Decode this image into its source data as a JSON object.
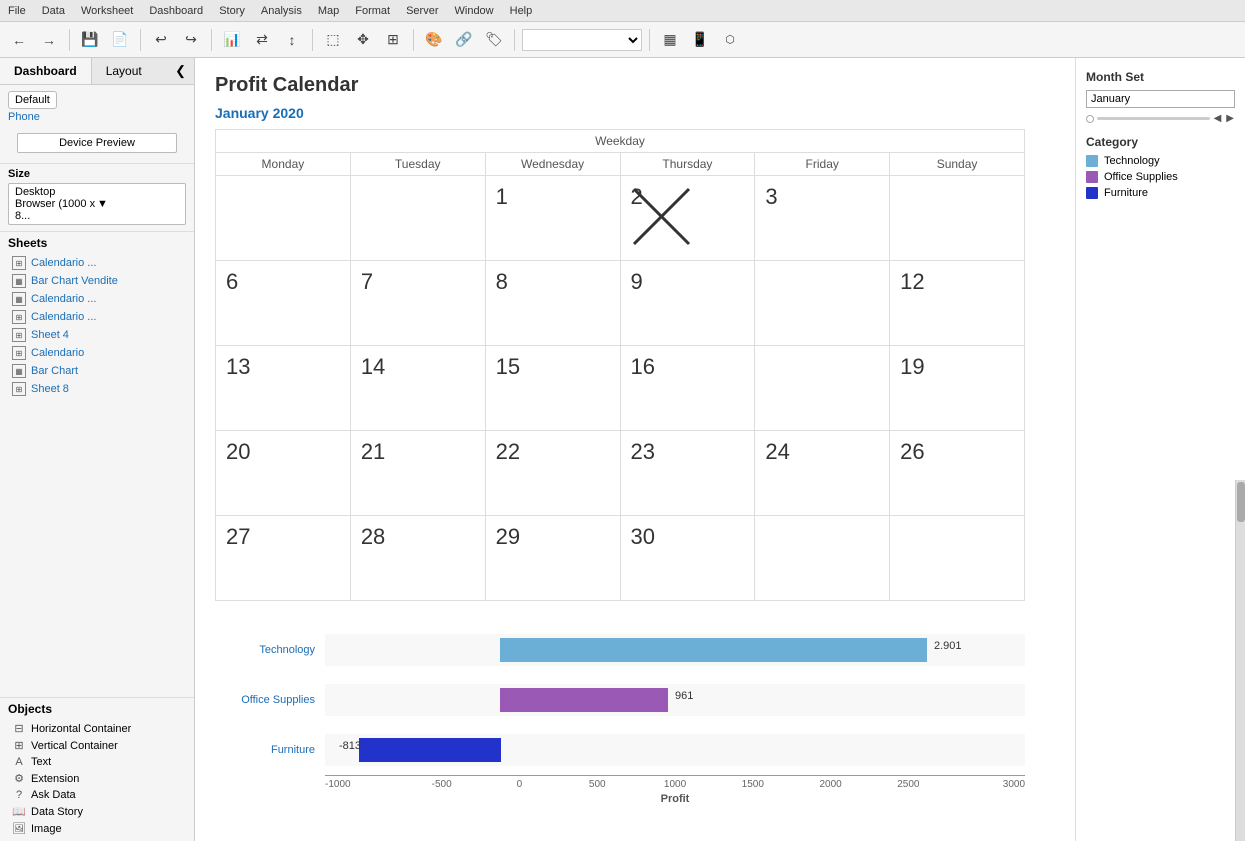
{
  "menubar": {
    "items": [
      "File",
      "Data",
      "Worksheet",
      "Dashboard",
      "Story",
      "Analysis",
      "Map",
      "Format",
      "Server",
      "Window",
      "Help"
    ]
  },
  "toolbar": {
    "back_tooltip": "Back",
    "forward_tooltip": "Forward",
    "undo_tooltip": "Undo",
    "redo_tooltip": "Redo",
    "dropdown_placeholder": ""
  },
  "sidebar": {
    "tab_dashboard": "Dashboard",
    "tab_layout": "Layout",
    "collapse_icon": "❮",
    "default_label": "Default",
    "phone_label": "Phone",
    "device_preview_btn": "Device Preview",
    "size_title": "Size",
    "size_value": "Desktop Browser (1000 x 8...",
    "sheets_title": "Sheets",
    "sheets": [
      {
        "label": "Calendario ...",
        "icon": "grid"
      },
      {
        "label": "Bar Chart Vendite",
        "icon": "bar"
      },
      {
        "label": "Calendario ...",
        "icon": "bar"
      },
      {
        "label": "Calendario ...",
        "icon": "grid"
      },
      {
        "label": "Sheet 4",
        "icon": "grid"
      },
      {
        "label": "Calendario",
        "icon": "grid"
      },
      {
        "label": "Bar Chart",
        "icon": "bar"
      },
      {
        "label": "Sheet 8",
        "icon": "grid"
      }
    ],
    "objects_title": "Objects",
    "objects": [
      {
        "label": "Horizontal Container",
        "icon": "⊞"
      },
      {
        "label": "Vertical Container",
        "icon": "⊟"
      },
      {
        "label": "Text",
        "icon": "A"
      },
      {
        "label": "Extension",
        "icon": "⚙"
      },
      {
        "label": "Ask Data",
        "icon": "?"
      },
      {
        "label": "Data Story",
        "icon": "📖"
      },
      {
        "label": "Image",
        "icon": "🖼"
      }
    ]
  },
  "dashboard": {
    "title": "Profit Calendar",
    "month_label": "January 2020"
  },
  "calendar": {
    "weekday_header": "Weekday",
    "columns": [
      "Monday",
      "Tuesday",
      "Wednesday",
      "Thursday",
      "Friday",
      "Sunday"
    ],
    "rows": [
      [
        "",
        "",
        "1",
        "2",
        "3",
        ""
      ],
      [
        "6",
        "7",
        "8",
        "9",
        "",
        "12"
      ],
      [
        "13",
        "14",
        "15",
        "16",
        "",
        "19"
      ],
      [
        "20",
        "21",
        "22",
        "23",
        "24",
        "26"
      ],
      [
        "27",
        "28",
        "29",
        "30",
        "",
        ""
      ]
    ],
    "crossed_cell": {
      "row": 0,
      "col": 3
    }
  },
  "barchart": {
    "bars": [
      {
        "label": "Technology",
        "value": 2901,
        "display": "2.901",
        "color": "#6baed6",
        "bar_width_pct": 85
      },
      {
        "label": "Office Supplies",
        "value": 961,
        "display": "961",
        "color": "#9b59b6",
        "bar_width_pct": 33
      },
      {
        "label": "Furniture",
        "value": -813,
        "display": "-813",
        "color": "#2233cc",
        "bar_width_pct": 24,
        "negative": true
      }
    ],
    "x_axis_ticks": [
      "-1000",
      "-500",
      "0",
      "500",
      "1000",
      "1500",
      "2000",
      "2500",
      "3000"
    ],
    "x_axis_label": "Profit"
  },
  "right_panel": {
    "month_set_title": "Month Set",
    "month_input_value": "January",
    "category_title": "Category",
    "legend": [
      {
        "label": "Technology",
        "color": "#6baed6"
      },
      {
        "label": "Office Supplies",
        "color": "#9b59b6"
      },
      {
        "label": "Furniture",
        "color": "#2233cc"
      }
    ]
  }
}
